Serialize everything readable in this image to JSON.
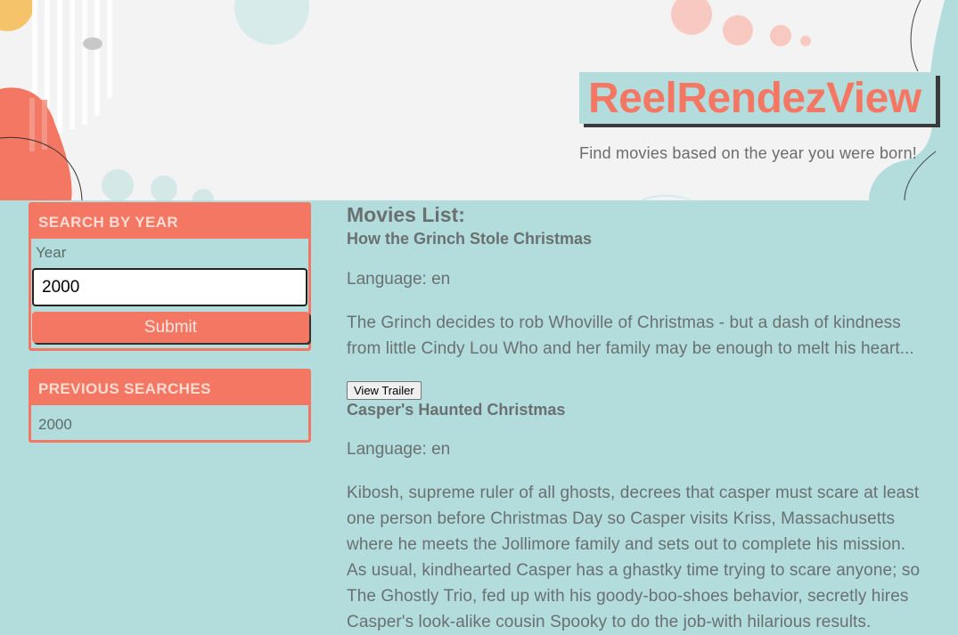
{
  "header": {
    "brand": "ReelRendezView",
    "tagline": "Find movies based on the year you were born!"
  },
  "search": {
    "heading": "SEARCH BY YEAR",
    "year_label": "Year",
    "year_value": "2000",
    "submit_label": "Submit"
  },
  "previous": {
    "heading": "PREVIOUS SEARCHES",
    "items": [
      "2000"
    ]
  },
  "movies": {
    "heading": "Movies List:",
    "items": [
      {
        "title": "How the Grinch Stole Christmas",
        "language": "Language: en",
        "overview": "The Grinch decides to rob Whoville of Christmas - but a dash of kindness from little Cindy Lou Who and her family may be enough to melt his heart...",
        "trailer_label": "View Trailer"
      },
      {
        "title": "Casper's Haunted Christmas",
        "language": "Language: en",
        "overview": "Kibosh, supreme ruler of all ghosts, decrees that casper must scare at least one person before Christmas Day so Casper visits Kriss, Massachusetts where he meets the Jollimore family and sets out to complete his mission. As usual, kindhearted Casper has a ghastky time trying to scare anyone; so The Ghostly Trio, fed up with his goody-boo-shoes behavior, secretly hires Casper's look-alike cousin Spooky to do the job-with hilarious results."
      }
    ]
  },
  "colors": {
    "accent": "#f47764",
    "teal": "#b3dcdc",
    "hero_bg": "#f3f3f3",
    "text": "#6a7070"
  }
}
